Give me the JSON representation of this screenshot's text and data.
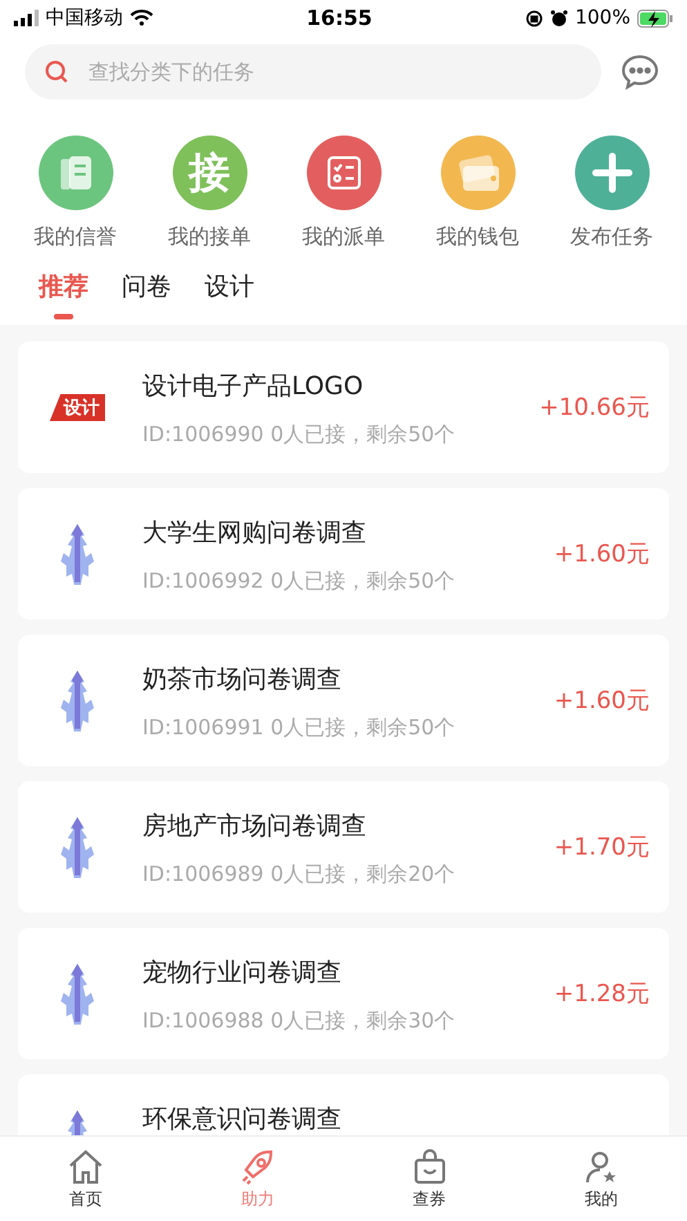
{
  "status_bar": {
    "carrier": "中国移动",
    "time": "16:55",
    "battery": "100%"
  },
  "search": {
    "placeholder": "查找分类下的任务"
  },
  "shortcuts": [
    {
      "kind": "credit",
      "label": "我的信誉",
      "color": "#6cc57f"
    },
    {
      "kind": "accept",
      "label": "我的接单",
      "glyph": "接",
      "color": "#7fc05a"
    },
    {
      "kind": "dispatch",
      "label": "我的派单",
      "color": "#e35f5f"
    },
    {
      "kind": "wallet",
      "label": "我的钱包",
      "color": "#f2b84f"
    },
    {
      "kind": "publish",
      "label": "发布任务",
      "color": "#4fb098"
    }
  ],
  "tabs": [
    {
      "label": "推荐",
      "selected": true
    },
    {
      "label": "问卷",
      "selected": false
    },
    {
      "label": "设计",
      "selected": false
    }
  ],
  "tasks": [
    {
      "kind": "design",
      "logo_text": "设计",
      "title": "设计电子产品LOGO",
      "meta": "ID:1006990  0人已接，剩余50个",
      "price": "+10.66元"
    },
    {
      "kind": "survey",
      "title": "大学生网购问卷调查",
      "meta": "ID:1006992  0人已接，剩余50个",
      "price": "+1.60元"
    },
    {
      "kind": "survey",
      "title": "奶茶市场问卷调查",
      "meta": "ID:1006991  0人已接，剩余50个",
      "price": "+1.60元"
    },
    {
      "kind": "survey",
      "title": "房地产市场问卷调查",
      "meta": "ID:1006989  0人已接，剩余20个",
      "price": "+1.70元"
    },
    {
      "kind": "survey",
      "title": "宠物行业问卷调查",
      "meta": "ID:1006988  0人已接，剩余30个",
      "price": "+1.28元"
    },
    {
      "kind": "survey",
      "title": "环保意识问卷调查"
    }
  ],
  "nav": [
    {
      "kind": "home",
      "label": "首页",
      "selected": false
    },
    {
      "kind": "rocket",
      "label": "助力",
      "selected": true
    },
    {
      "kind": "bag",
      "label": "查券",
      "selected": false
    },
    {
      "kind": "user",
      "label": "我的",
      "selected": false
    }
  ]
}
